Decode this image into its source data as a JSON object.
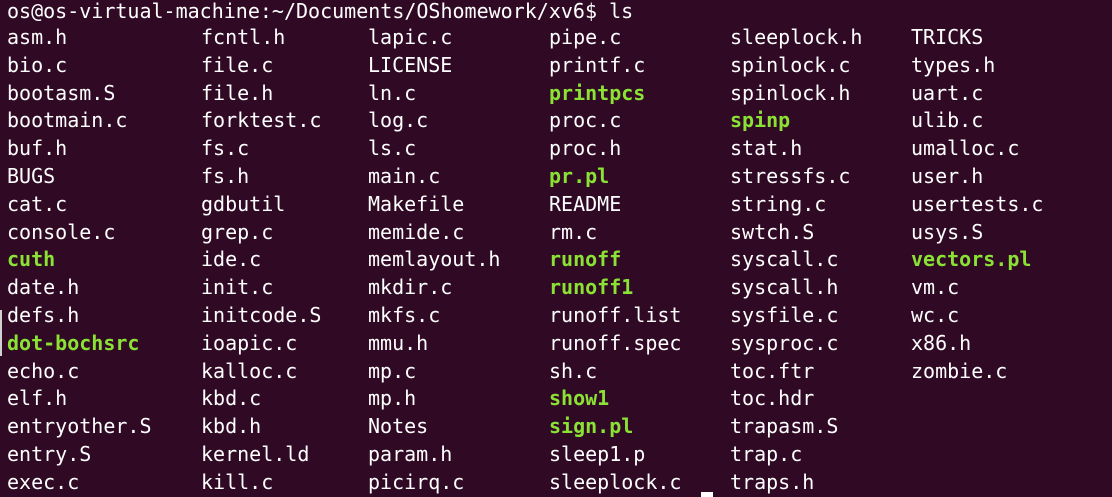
{
  "terminal": {
    "prompt": "os@os-virtual-machine:~/Documents/OShomework/xv6$",
    "command": "ls",
    "colors": {
      "background": "#300a24",
      "foreground": "#ffffff",
      "executable": "#8ae234"
    },
    "ls_columns": [
      [
        {
          "name": "asm.h"
        },
        {
          "name": "bio.c"
        },
        {
          "name": "bootasm.S"
        },
        {
          "name": "bootmain.c"
        },
        {
          "name": "buf.h"
        },
        {
          "name": "BUGS"
        },
        {
          "name": "cat.c"
        },
        {
          "name": "console.c"
        },
        {
          "name": "cuth",
          "exec": true
        },
        {
          "name": "date.h"
        },
        {
          "name": "defs.h"
        },
        {
          "name": "dot-bochsrc",
          "exec": true
        },
        {
          "name": "echo.c"
        },
        {
          "name": "elf.h"
        },
        {
          "name": "entryother.S"
        },
        {
          "name": "entry.S"
        },
        {
          "name": "exec.c"
        }
      ],
      [
        {
          "name": "fcntl.h"
        },
        {
          "name": "file.c"
        },
        {
          "name": "file.h"
        },
        {
          "name": "forktest.c"
        },
        {
          "name": "fs.c"
        },
        {
          "name": "fs.h"
        },
        {
          "name": "gdbutil"
        },
        {
          "name": "grep.c"
        },
        {
          "name": "ide.c"
        },
        {
          "name": "init.c"
        },
        {
          "name": "initcode.S"
        },
        {
          "name": "ioapic.c"
        },
        {
          "name": "kalloc.c"
        },
        {
          "name": "kbd.c"
        },
        {
          "name": "kbd.h"
        },
        {
          "name": "kernel.ld"
        },
        {
          "name": "kill.c"
        }
      ],
      [
        {
          "name": "lapic.c"
        },
        {
          "name": "LICENSE"
        },
        {
          "name": "ln.c"
        },
        {
          "name": "log.c"
        },
        {
          "name": "ls.c"
        },
        {
          "name": "main.c"
        },
        {
          "name": "Makefile"
        },
        {
          "name": "memide.c"
        },
        {
          "name": "memlayout.h"
        },
        {
          "name": "mkdir.c"
        },
        {
          "name": "mkfs.c"
        },
        {
          "name": "mmu.h"
        },
        {
          "name": "mp.c"
        },
        {
          "name": "mp.h"
        },
        {
          "name": "Notes"
        },
        {
          "name": "param.h"
        },
        {
          "name": "picirq.c"
        }
      ],
      [
        {
          "name": "pipe.c"
        },
        {
          "name": "printf.c"
        },
        {
          "name": "printpcs",
          "exec": true
        },
        {
          "name": "proc.c"
        },
        {
          "name": "proc.h"
        },
        {
          "name": "pr.pl",
          "exec": true
        },
        {
          "name": "README"
        },
        {
          "name": "rm.c"
        },
        {
          "name": "runoff",
          "exec": true
        },
        {
          "name": "runoff1",
          "exec": true
        },
        {
          "name": "runoff.list"
        },
        {
          "name": "runoff.spec"
        },
        {
          "name": "sh.c"
        },
        {
          "name": "show1",
          "exec": true
        },
        {
          "name": "sign.pl",
          "exec": true
        },
        {
          "name": "sleep1.p"
        },
        {
          "name": "sleeplock.c"
        }
      ],
      [
        {
          "name": "sleeplock.h"
        },
        {
          "name": "spinlock.c"
        },
        {
          "name": "spinlock.h"
        },
        {
          "name": "spinp",
          "exec": true
        },
        {
          "name": "stat.h"
        },
        {
          "name": "stressfs.c"
        },
        {
          "name": "string.c"
        },
        {
          "name": "swtch.S"
        },
        {
          "name": "syscall.c"
        },
        {
          "name": "syscall.h"
        },
        {
          "name": "sysfile.c"
        },
        {
          "name": "sysproc.c"
        },
        {
          "name": "toc.ftr"
        },
        {
          "name": "toc.hdr"
        },
        {
          "name": "trapasm.S"
        },
        {
          "name": "trap.c"
        },
        {
          "name": "traps.h"
        }
      ],
      [
        {
          "name": "TRICKS"
        },
        {
          "name": "types.h"
        },
        {
          "name": "uart.c"
        },
        {
          "name": "ulib.c"
        },
        {
          "name": "umalloc.c"
        },
        {
          "name": "user.h"
        },
        {
          "name": "usertests.c"
        },
        {
          "name": "usys.S"
        },
        {
          "name": "vectors.pl",
          "exec": true
        },
        {
          "name": "vm.c"
        },
        {
          "name": "wc.c"
        },
        {
          "name": "x86.h"
        },
        {
          "name": "zombie.c"
        }
      ]
    ]
  }
}
